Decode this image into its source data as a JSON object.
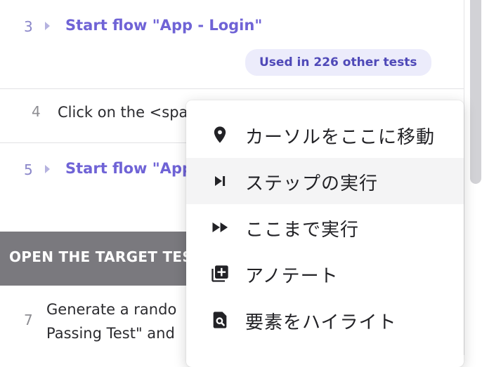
{
  "steps": {
    "s3": {
      "number": "3",
      "title": "Start flow \"App - Login\"",
      "badge": "Used in 226 other tests"
    },
    "s4": {
      "number": "4",
      "text": "Click on the <spa"
    },
    "s5": {
      "number": "5",
      "title": "Start flow \"App"
    },
    "s7": {
      "number": "7",
      "line1": "Generate a rando",
      "line2": "Passing Test\" and"
    }
  },
  "section": {
    "title": "OPEN THE TARGET TES"
  },
  "context_menu": {
    "items": [
      {
        "label": "カーソルをここに移動",
        "icon": "location-pin-icon"
      },
      {
        "label": "ステップの実行",
        "icon": "skip-next-icon"
      },
      {
        "label": "ここまで実行",
        "icon": "fast-forward-icon"
      },
      {
        "label": "アノテート",
        "icon": "add-note-icon"
      },
      {
        "label": "要素をハイライト",
        "icon": "find-in-page-icon"
      }
    ]
  },
  "colors": {
    "flow_title": "#6f63d6",
    "badge_bg": "#ececfb",
    "section_bar": "#7a797e",
    "menu_hover": "#f4f4f5"
  }
}
